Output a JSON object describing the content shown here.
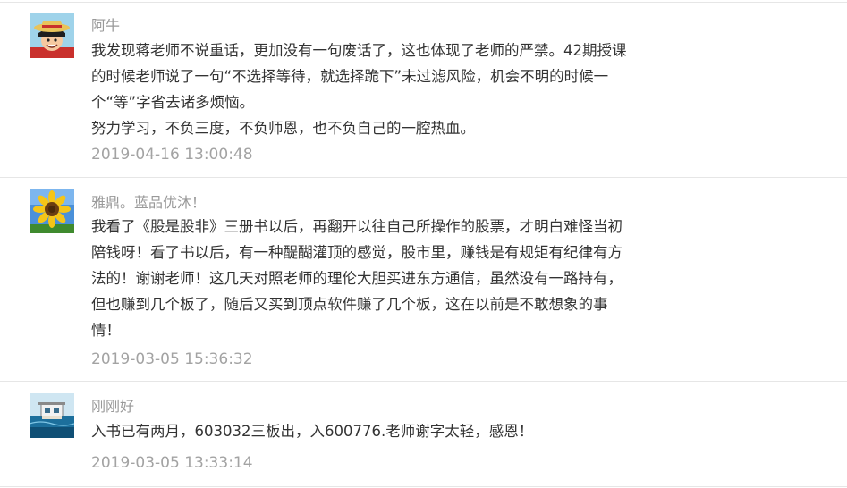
{
  "comments": [
    {
      "avatar_icon": "anime-straw-hat-avatar-icon",
      "username": "阿牛",
      "lines": [
        "我发现蒋老师不说重话，更加没有一句废话了，这也体现了老师的严禁。42期授课",
        "的时候老师说了一句“不选择等待，就选择跪下”未过滤风险，机会不明的时候一",
        "个“等”字省去诸多烦恼。",
        "努力学习，不负三度，不负师恩，也不负自己的一腔热血。"
      ],
      "timestamp": "2019-04-16 13:00:48"
    },
    {
      "avatar_icon": "sunflower-avatar-icon",
      "username": "雅鼎。蓝品优沐！",
      "lines": [
        "我看了《股是股非》三册书以后，再翻开以往自己所操作的股票，才明白难怪当初",
        "陪钱呀！看了书以后，有一种醍醐灌顶的感觉，股市里，赚钱是有规矩有纪律有方",
        "法的！谢谢老师！这几天对照老师的理伦大胆买进东方通信，虽然没有一路持有，",
        "但也赚到几个板了，随后又买到顶点软件赚了几个板，这在以前是不敢想象的事",
        "情！"
      ],
      "timestamp": "2019-03-05 15:36:32"
    },
    {
      "avatar_icon": "seaside-house-avatar-icon",
      "username": "刚刚好",
      "lines": [
        "入书已有两月，603032三板出，入600776.老师谢字太轻，感恩！"
      ],
      "timestamp": "2019-03-05 13:33:14"
    }
  ]
}
